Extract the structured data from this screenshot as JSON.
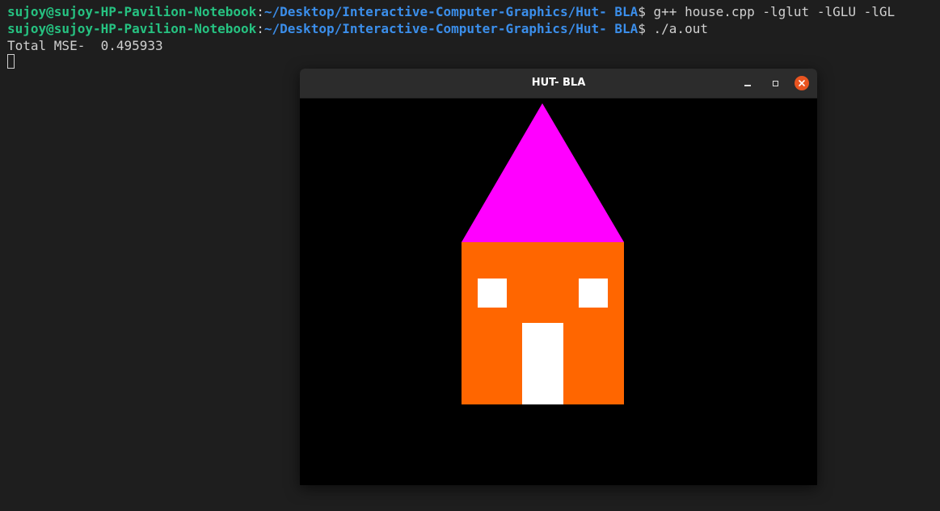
{
  "terminal": {
    "lines": [
      {
        "user": "sujoy@sujoy-HP-Pavilion-Notebook",
        "sep": ":",
        "path": "~/Desktop/Interactive-Computer-Graphics/Hut- BLA",
        "prompt": "$ ",
        "command": "g++ house.cpp -lglut -lGLU -lGL"
      },
      {
        "user": "sujoy@sujoy-HP-Pavilion-Notebook",
        "sep": ":",
        "path": "~/Desktop/Interactive-Computer-Graphics/Hut- BLA",
        "prompt": "$ ",
        "command": "./a.out"
      }
    ],
    "output": "Total MSE-  0.495933"
  },
  "window": {
    "title": "HUT- BLA",
    "minimize_icon": "minimize-icon",
    "maximize_icon": "maximize-icon",
    "close_icon": "close-icon"
  },
  "colors": {
    "terminal_bg": "#1e1e1e",
    "user_green": "#26c281",
    "path_blue": "#3b8eea",
    "roof": "#ff00ff",
    "walls": "#ff6600",
    "windows_door": "#ffffff",
    "canvas_bg": "#000000",
    "close_button": "#e95420"
  }
}
